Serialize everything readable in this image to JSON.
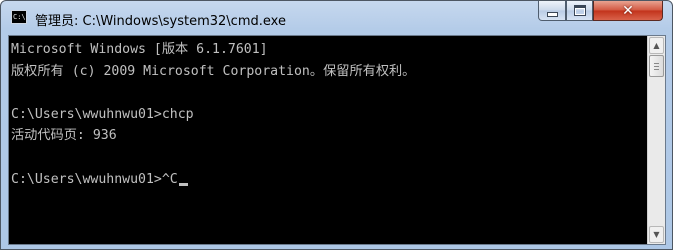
{
  "window": {
    "title": "管理员: C:\\Windows\\system32\\cmd.exe",
    "icon": "cmd-icon",
    "icon_text": "C:\\."
  },
  "controls": {
    "minimize_icon": "minimize-icon",
    "maximize_icon": "maximize-icon",
    "close_icon": "close-icon",
    "close_glyph": "✕"
  },
  "console": {
    "background": "#000000",
    "foreground": "#c0c0c0",
    "lines": [
      "Microsoft Windows [版本 6.1.7601]",
      "版权所有 (c) 2009 Microsoft Corporation。保留所有权利。",
      "",
      "C:\\Users\\wwuhnwu01>chcp",
      "活动代码页: 936",
      "",
      "C:\\Users\\wwuhnwu01>^C"
    ]
  },
  "scrollbar": {
    "up_glyph": "▲",
    "down_glyph": "▼"
  }
}
